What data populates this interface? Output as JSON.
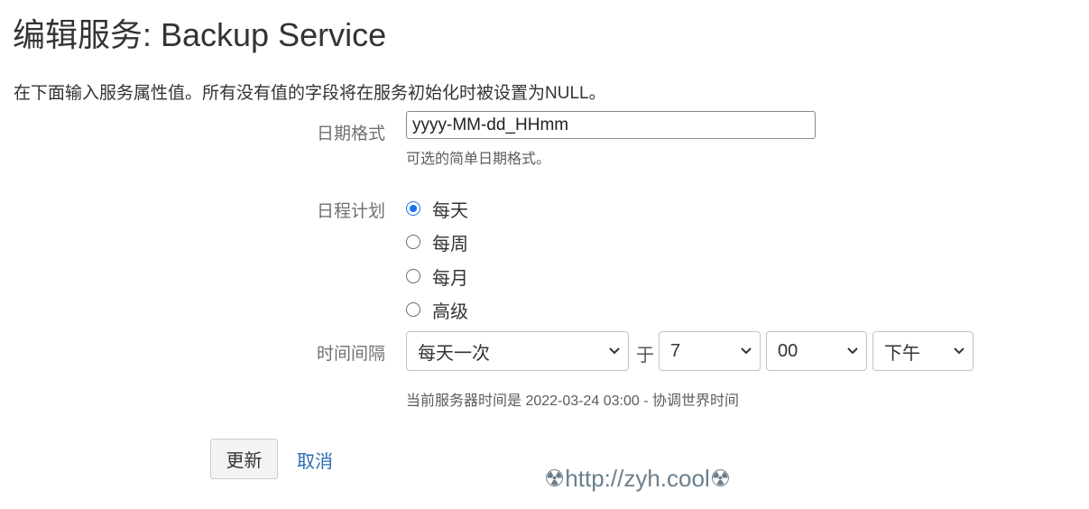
{
  "page": {
    "title": "编辑服务: Backup Service",
    "description": "在下面输入服务属性值。所有没有值的字段将在服务初始化时被设置为NULL。"
  },
  "form": {
    "date_format": {
      "label": "日期格式",
      "value": "yyyy-MM-dd_HHmm",
      "help": "可选的简单日期格式。"
    },
    "schedule": {
      "label": "日程计划",
      "selected": "每天",
      "options": [
        "每天",
        "每周",
        "每月",
        "高级"
      ]
    },
    "interval": {
      "label": "时间间隔",
      "frequency": "每天一次",
      "at_label": "于",
      "hour": "7",
      "minute": "00",
      "ampm": "下午",
      "server_time_note": "当前服务器时间是 2022-03-24 03:00 - 协调世界时间"
    }
  },
  "actions": {
    "update_label": "更新",
    "cancel_label": "取消"
  },
  "watermark": "☢http://zyh.cool☢",
  "colors": {
    "link": "#2a6cb0",
    "radio_checked": "#1a73e8",
    "label_text": "#707070"
  },
  "icons": {
    "radio_checked": "radio-checked-icon",
    "radio_unchecked": "radio-unchecked-icon",
    "select_arrow": "chevron-down-icon"
  }
}
